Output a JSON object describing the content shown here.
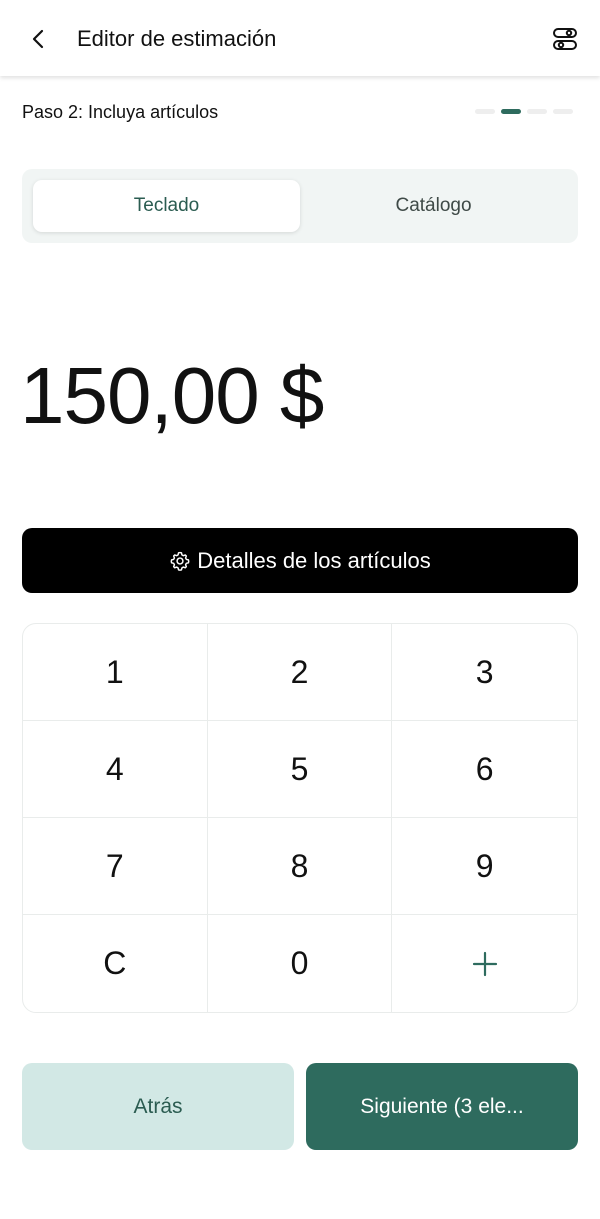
{
  "header": {
    "title": "Editor de estimación",
    "back_icon": "chevron-left-icon",
    "settings_icon": "toggles-icon"
  },
  "step": {
    "label": "Paso 2: Incluya artículos",
    "total_steps": 4,
    "current_step": 2,
    "active_color": "#2e6b5e"
  },
  "tabs": [
    {
      "label": "Teclado",
      "selected": true
    },
    {
      "label": "Catálogo",
      "selected": false
    }
  ],
  "amount": "150,00 $",
  "details_button": {
    "label": "Detalles de los artículos",
    "icon": "gear-icon"
  },
  "keypad": {
    "keys": [
      "1",
      "2",
      "3",
      "4",
      "5",
      "6",
      "7",
      "8",
      "9",
      "C",
      "0",
      "+"
    ]
  },
  "footer": {
    "back_label": "Atrás",
    "next_label": "Siguiente (3 ele..."
  },
  "colors": {
    "brand": "#2e6b5e",
    "brand_light": "#d2e8e5",
    "dark_button": "#000000"
  }
}
